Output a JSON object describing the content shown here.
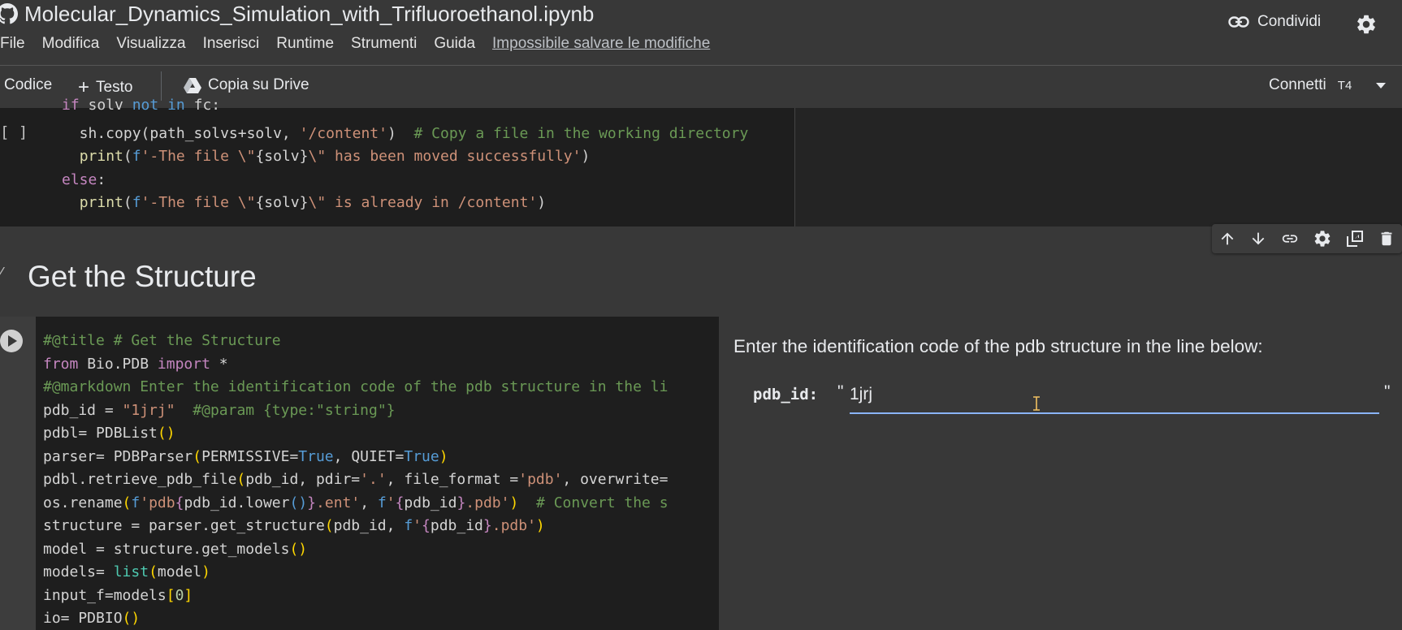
{
  "app": {
    "title": "Molecular_Dynamics_Simulation_with_Trifluoroethanol.ipynb",
    "share_label": "Condividi"
  },
  "menu": [
    "File",
    "Modifica",
    "Visualizza",
    "Inserisci",
    "Runtime",
    "Strumenti",
    "Guida"
  ],
  "save_warning": "Impossibile salvare le modifiche",
  "toolbar": {
    "code_label": "Codice",
    "text_label": "Testo",
    "drive_label": "Copia su Drive",
    "connect_label": "Connetti",
    "runtime_type": "T4"
  },
  "cell1": {
    "bracket": "[ ]"
  },
  "section": {
    "heading": "Get the Structure"
  },
  "form": {
    "description": "Enter the identification code of the pdb structure in the line below:",
    "label": "pdb_id:",
    "quote_open": "\"",
    "quote_close": "\"",
    "value": "1jrj"
  },
  "colors": {
    "background": "#383838",
    "code_background": "#1e1e1e",
    "input_underline": "#8ab4f8"
  }
}
